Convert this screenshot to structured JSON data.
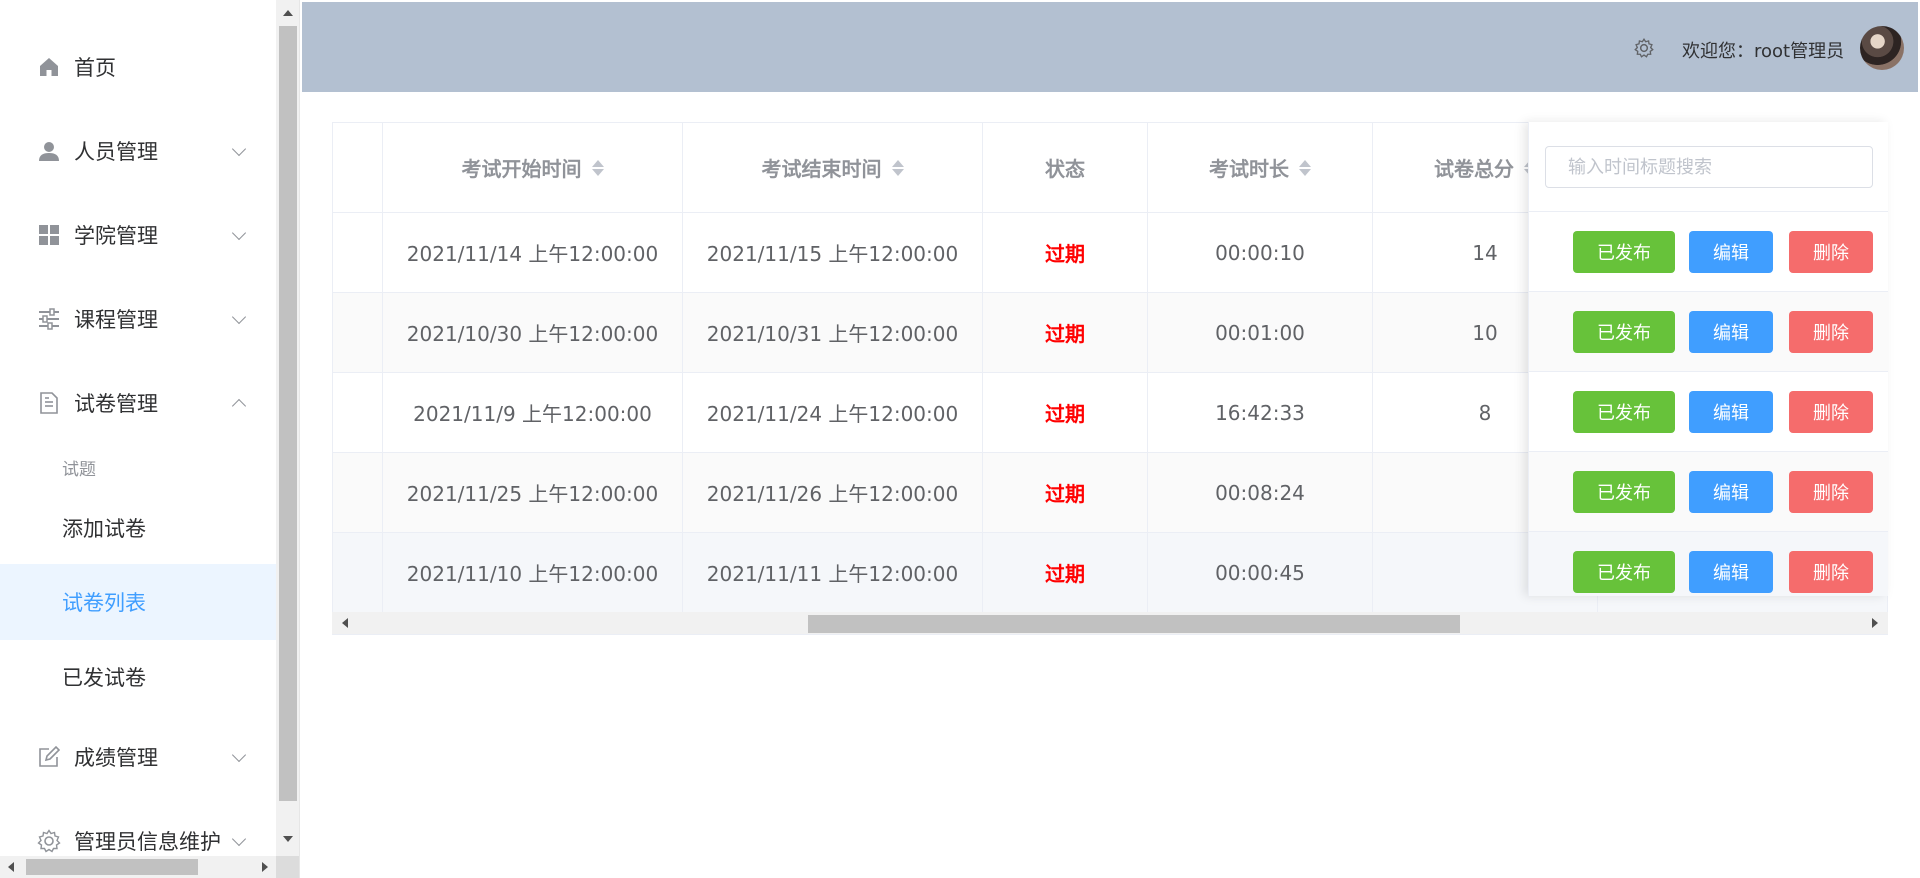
{
  "sidebar": {
    "items": [
      {
        "label": "首页",
        "icon": "home-icon"
      },
      {
        "label": "人员管理",
        "icon": "user-icon"
      },
      {
        "label": "学院管理",
        "icon": "grid-icon"
      },
      {
        "label": "课程管理",
        "icon": "sliders-icon"
      },
      {
        "label": "试卷管理",
        "icon": "document-icon",
        "expanded": true
      },
      {
        "label": "成绩管理",
        "icon": "edit-icon"
      },
      {
        "label": "管理员信息维护",
        "icon": "gear-icon"
      }
    ],
    "submenu": {
      "group_title": "试题",
      "items": [
        {
          "label": "添加试卷"
        },
        {
          "label": "试卷列表",
          "active": true
        },
        {
          "label": "已发试卷"
        }
      ]
    }
  },
  "header": {
    "welcome": "欢迎您：root管理员",
    "bg_color": "#b3c0d1"
  },
  "table": {
    "columns": [
      "考试开始时间",
      "考试结束时间",
      "状态",
      "考试时长",
      "试卷总分"
    ],
    "search_placeholder": "输入时间标题搜索",
    "rows": [
      {
        "start": "2021/11/14 上午12:00:00",
        "end": "2021/11/15 上午12:00:00",
        "status": "过期",
        "duration": "00:00:10",
        "score": "14"
      },
      {
        "start": "2021/10/30 上午12:00:00",
        "end": "2021/10/31 上午12:00:00",
        "status": "过期",
        "duration": "00:01:00",
        "score": "10"
      },
      {
        "start": "2021/11/9 上午12:00:00",
        "end": "2021/11/24 上午12:00:00",
        "status": "过期",
        "duration": "16:42:33",
        "score": "8"
      },
      {
        "start": "2021/11/25 上午12:00:00",
        "end": "2021/11/26 上午12:00:00",
        "status": "过期",
        "duration": "00:08:24",
        "score": ""
      },
      {
        "start": "2021/11/10 上午12:00:00",
        "end": "2021/11/11 上午12:00:00",
        "status": "过期",
        "duration": "00:00:45",
        "score": ""
      }
    ],
    "actions": {
      "publish": "已发布",
      "edit": "编辑",
      "delete": "删除"
    }
  },
  "colors": {
    "primary": "#409eff",
    "success": "#67c23a",
    "danger": "#f56c6c",
    "expired": "#ff0000"
  }
}
